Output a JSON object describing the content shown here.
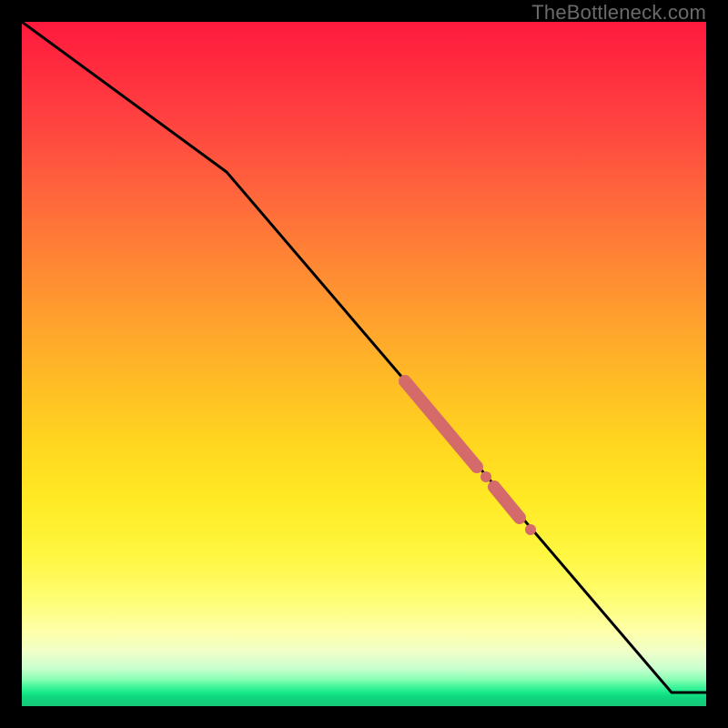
{
  "watermark": "TheBottleneck.com",
  "chart_data": {
    "type": "line",
    "title": "",
    "xlabel": "",
    "ylabel": "",
    "xlim": [
      0,
      100
    ],
    "ylim": [
      0,
      100
    ],
    "series": [
      {
        "name": "curve",
        "x": [
          0,
          30,
          95,
          100
        ],
        "values": [
          100,
          78,
          2,
          2
        ]
      }
    ],
    "markers": [
      {
        "name": "segment-a",
        "x0": 56,
        "y0": 47.5,
        "x1": 66.5,
        "y1": 35,
        "thickness": 10
      },
      {
        "name": "segment-b",
        "x0": 69,
        "y0": 32,
        "x1": 72.8,
        "y1": 27.5,
        "thickness": 10
      },
      {
        "name": "dot-mid",
        "cx": 67.8,
        "cy": 33.5,
        "r": 4.2
      },
      {
        "name": "dot-low",
        "cx": 74.3,
        "cy": 25.8,
        "r": 4.2
      }
    ],
    "marker_color": "#d46a6a",
    "gradient_stops": [
      {
        "pos": 0,
        "color": "#ff1a3e"
      },
      {
        "pos": 50,
        "color": "#ffc024"
      },
      {
        "pos": 85,
        "color": "#fffd70"
      },
      {
        "pos": 97,
        "color": "#40f59a"
      },
      {
        "pos": 100,
        "color": "#14c878"
      }
    ]
  }
}
